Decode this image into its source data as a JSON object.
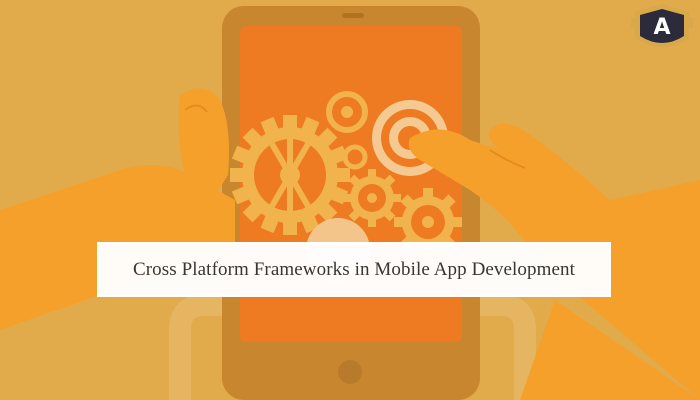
{
  "banner": {
    "title": "Cross Platform Frameworks in Mobile App Development"
  },
  "logo": {
    "letter": "A"
  },
  "colors": {
    "background": "#e1aa4b",
    "tablet_frame": "#c8862e",
    "tablet_screen": "#ee7a22",
    "hand": "#f6a02c",
    "gear": "#f1b34c",
    "badge_dark": "#2b2b3b",
    "badge_gold": "#d8a84a"
  },
  "icons": [
    "gear-icon",
    "target-icon",
    "shield-badge-icon"
  ]
}
